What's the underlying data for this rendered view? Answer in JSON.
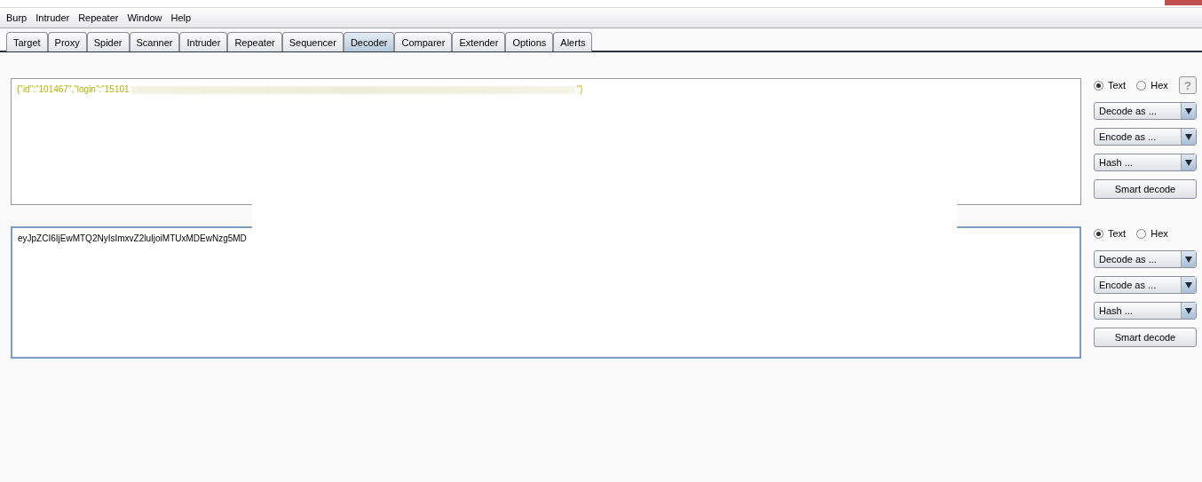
{
  "menu": [
    "Burp",
    "Intruder",
    "Repeater",
    "Window",
    "Help"
  ],
  "tabs": [
    {
      "label": "Target",
      "selected": false
    },
    {
      "label": "Proxy",
      "selected": false
    },
    {
      "label": "Spider",
      "selected": false
    },
    {
      "label": "Scanner",
      "selected": false
    },
    {
      "label": "Intruder",
      "selected": false
    },
    {
      "label": "Repeater",
      "selected": false
    },
    {
      "label": "Sequencer",
      "selected": false
    },
    {
      "label": "Decoder",
      "selected": true
    },
    {
      "label": "Comparer",
      "selected": false
    },
    {
      "label": "Extender",
      "selected": false
    },
    {
      "label": "Options",
      "selected": false
    },
    {
      "label": "Alerts",
      "selected": false
    }
  ],
  "panels": [
    {
      "kind": "decoded",
      "focused": false,
      "segments": [
        {
          "kind": "text",
          "text": "{\"id\":\"101467\",\"login\":\"15101"
        },
        {
          "kind": "redacted"
        },
        {
          "kind": "text",
          "text": "\"}"
        }
      ],
      "formats": [
        {
          "label": "Text",
          "selected": true
        },
        {
          "label": "Hex",
          "selected": false
        }
      ],
      "help": "?",
      "dropdowns": [
        "Decode as ...",
        "Encode as ...",
        "Hash ..."
      ],
      "button": "Smart decode"
    },
    {
      "kind": "encoded",
      "focused": true,
      "segments": [
        {
          "kind": "text",
          "text": "eyJpZCI6IjEwMTQ2NyIsImxvZ2luIjoiMTUxMDEwNzg5MD"
        }
      ],
      "formats": [
        {
          "label": "Text",
          "selected": true
        },
        {
          "label": "Hex",
          "selected": false
        }
      ],
      "dropdowns": [
        "Decode as ...",
        "Encode as ...",
        "Hash ..."
      ],
      "button": "Smart decode"
    }
  ],
  "redaction_overlay": true
}
